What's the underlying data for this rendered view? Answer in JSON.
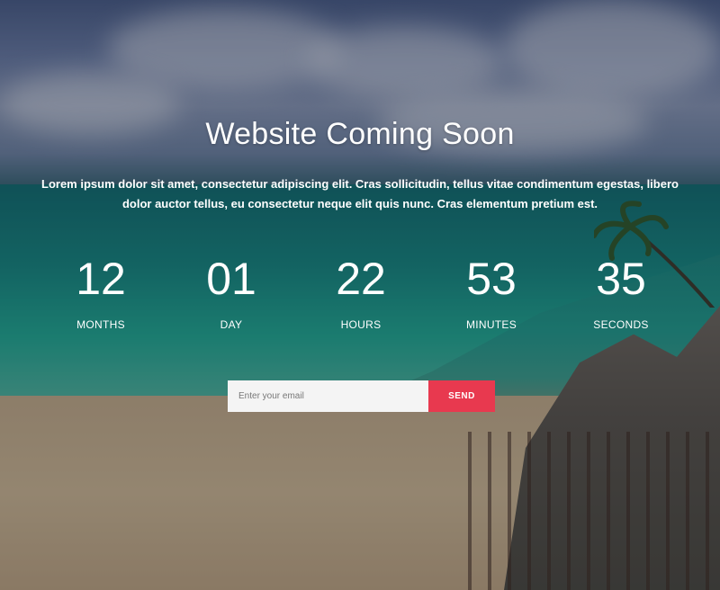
{
  "hero": {
    "title": "Website Coming Soon",
    "description": "Lorem ipsum dolor sit amet, consectetur adipiscing elit. Cras sollicitudin, tellus vitae condimentum egestas, libero dolor auctor tellus, eu consectetur neque elit quis nunc. Cras elementum pretium est."
  },
  "countdown": [
    {
      "value": "12",
      "label": "MONTHS"
    },
    {
      "value": "01",
      "label": "DAY"
    },
    {
      "value": "22",
      "label": "HOURS"
    },
    {
      "value": "53",
      "label": "MINUTES"
    },
    {
      "value": "35",
      "label": "SECONDS"
    }
  ],
  "subscribe": {
    "placeholder": "Enter your email",
    "value": "",
    "button_label": "SEND"
  },
  "colors": {
    "accent": "#e8394f",
    "input_bg": "#f4f4f4",
    "text": "#ffffff"
  }
}
